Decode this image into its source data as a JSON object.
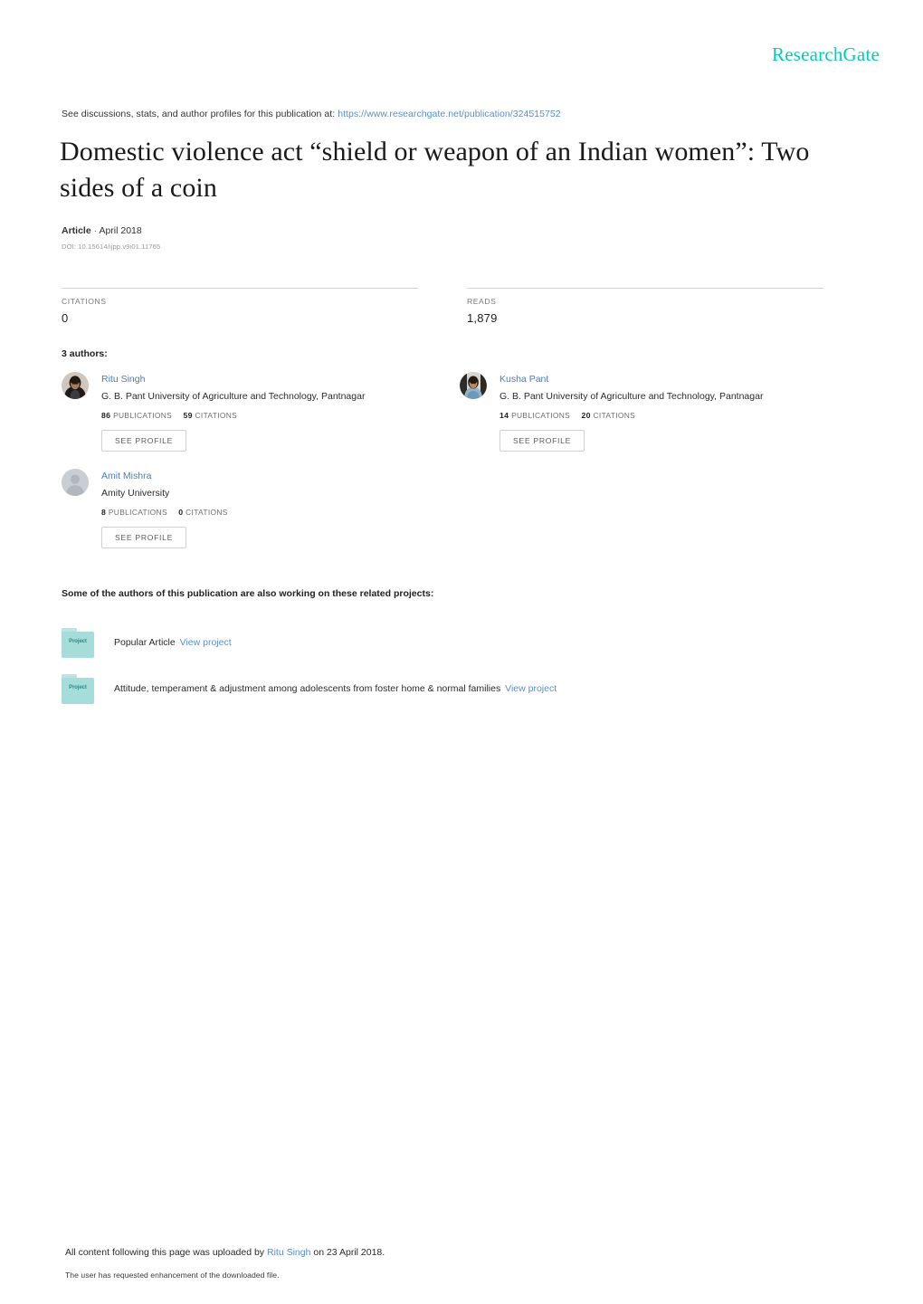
{
  "brand": {
    "logo_text": "ResearchGate"
  },
  "discussion": {
    "prefix": "See discussions, stats, and author profiles for this publication at:",
    "url": "https://www.researchgate.net/publication/324515752"
  },
  "publication": {
    "title": "Domestic violence act “shield or weapon of an Indian women”: Two sides of a coin",
    "type": "Article",
    "separator": "·",
    "date": "April 2018",
    "doi": "DOI: 10.15614/ijpp.v9i01.11765"
  },
  "metrics": [
    {
      "label": "CITATIONS",
      "value": "0"
    },
    {
      "label": "READS",
      "value": "1,879"
    }
  ],
  "authors_section": {
    "heading": "3 authors:",
    "see_profile_label": "SEE PROFILE",
    "publications_label": "PUBLICATIONS",
    "citations_label": "CITATIONS",
    "authors": [
      {
        "name": "Ritu Singh",
        "affiliation": "G. B. Pant University of Agriculture and Technology, Pantnagar",
        "publications": "86",
        "citations": "59",
        "avatar": "photo-female-1"
      },
      {
        "name": "Kusha Pant",
        "affiliation": "G. B. Pant University of Agriculture and Technology, Pantnagar",
        "publications": "14",
        "citations": "20",
        "avatar": "photo-female-2"
      },
      {
        "name": "Amit Mishra",
        "affiliation": "Amity University",
        "publications": "8",
        "citations": "0",
        "avatar": "placeholder-silhouette"
      }
    ]
  },
  "projects_section": {
    "heading": "Some of the authors of this publication are also working on these related projects:",
    "icon_label": "Project",
    "view_label": "View project",
    "projects": [
      {
        "title": "Popular Article"
      },
      {
        "title": "Attitude, temperament & adjustment among adolescents from foster home & normal families"
      }
    ]
  },
  "footer": {
    "upload_prefix": "All content following this page was uploaded by",
    "uploader": "Ritu Singh",
    "upload_suffix": "on 23 April 2018.",
    "note": "The user has requested enhancement of the downloaded file."
  },
  "colors": {
    "brand_teal": "#00ccbb",
    "link_blue": "#5b8fc9",
    "author_link": "#4a7ebb",
    "folder_teal": "#a6dcd9"
  }
}
